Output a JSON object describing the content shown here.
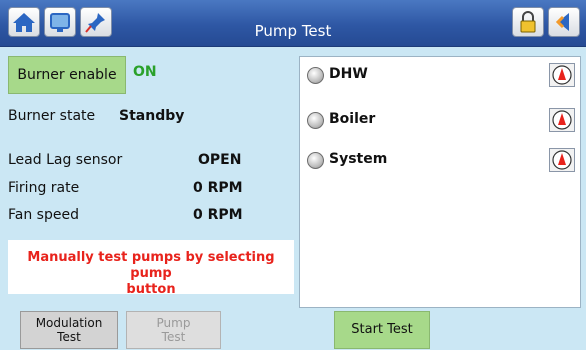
{
  "header": {
    "title": "Pump Test",
    "left_icons": [
      "home-icon",
      "display-icon",
      "pin-icon"
    ],
    "right_icons": [
      "lock-icon",
      "back-icon"
    ]
  },
  "burner": {
    "enable_label": "Burner enable",
    "enable_status": "ON",
    "state_label": "Burner state",
    "state_value": "Standby"
  },
  "readings": [
    {
      "label": "Lead Lag sensor",
      "value": "OPEN"
    },
    {
      "label": "Firing rate",
      "value": "0 RPM"
    },
    {
      "label": "Fan speed",
      "value": "0 RPM"
    }
  ],
  "message": {
    "line1": "Manually test pumps by selecting pump",
    "line2": "button"
  },
  "pumps": [
    {
      "label": "DHW"
    },
    {
      "label": "Boiler"
    },
    {
      "label": "System"
    }
  ],
  "buttons": {
    "modulation_line1": "Modulation",
    "modulation_line2": "Test",
    "pump_line1": "Pump",
    "pump_line2": "Test",
    "start": "Start Test"
  },
  "colors": {
    "background": "#cbe7f4",
    "titlebar": "#2e57a4",
    "accent_green": "#a7d98a",
    "status_green": "#2aa12a",
    "message_red": "#e8231c"
  }
}
